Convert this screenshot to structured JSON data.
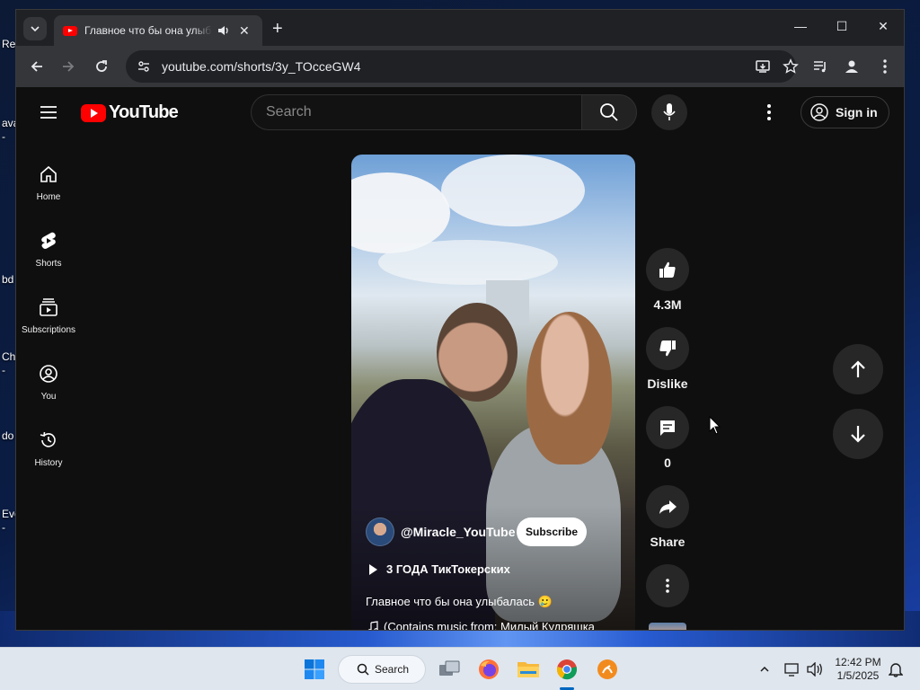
{
  "desktop": {
    "labels": [
      "Re",
      "ava",
      "-",
      "bd",
      "Ch",
      "-",
      "do",
      "Eve",
      "-"
    ]
  },
  "browser": {
    "tab": {
      "title": "Главное что бы она улыбалась",
      "favicon": "youtube-favicon"
    },
    "url": "youtube.com/shorts/3y_TOcceGW4"
  },
  "youtube": {
    "logo_text": "YouTube",
    "search": {
      "placeholder": "Search"
    },
    "sign_in_label": "Sign in",
    "sidebar": [
      {
        "label": "Home",
        "icon": "home-icon"
      },
      {
        "label": "Shorts",
        "icon": "shorts-icon"
      },
      {
        "label": "Subscriptions",
        "icon": "subscriptions-icon"
      },
      {
        "label": "You",
        "icon": "you-icon"
      },
      {
        "label": "History",
        "icon": "history-icon"
      }
    ],
    "short": {
      "channel": "@Miracle_YouTube",
      "subscribe_label": "Subscribe",
      "playlist": "3 ГОДА ТикТокерских",
      "caption": "Главное что бы она улыбалась 🥲",
      "music": "(Contains music from: Милый Кудряшка"
    },
    "actions": {
      "like_count": "4.3M",
      "dislike_label": "Dislike",
      "comment_count": "0",
      "share_label": "Share"
    }
  },
  "taskbar": {
    "search_label": "Search",
    "time": "12:42 PM",
    "date": "1/5/2025",
    "apps": [
      "windows-start-icon",
      "task-view-icon",
      "firefox-icon",
      "file-explorer-icon",
      "chrome-icon",
      "app-icon"
    ]
  },
  "colors": {
    "youtube_red": "#ff0000",
    "page_bg": "#0f0f0f",
    "taskbar_bg": "#dfe6ee"
  }
}
